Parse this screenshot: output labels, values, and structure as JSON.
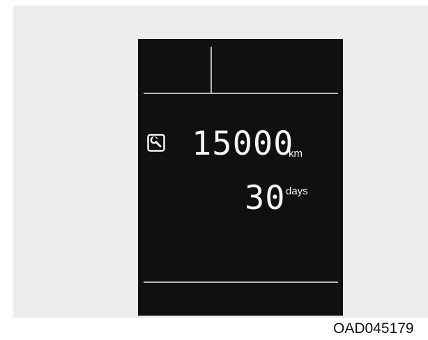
{
  "figure": {
    "code": "OAD045179"
  },
  "display": {
    "service_icon": "wrench-icon",
    "distance": {
      "value": "15000",
      "unit": "km"
    },
    "days": {
      "value": "30",
      "unit": "days"
    }
  },
  "colors": {
    "panel_background": "#ececec",
    "screen_background": "#101010",
    "display_text": "#f5f5f5",
    "divider": "#b8b8b8"
  }
}
